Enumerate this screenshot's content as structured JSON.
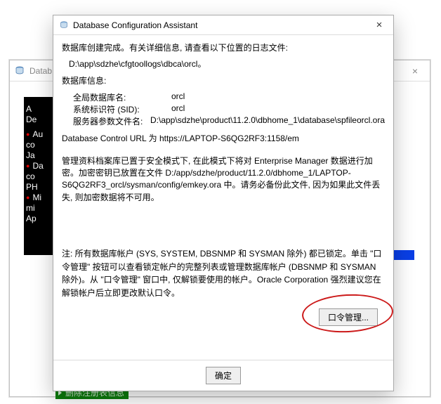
{
  "parentWindow": {
    "titlePrefix": "Datab",
    "close": "×",
    "blackPanel": {
      "l1": "A",
      "l2": "De",
      "l3": "Au",
      "l4": "co",
      "l5": "Ja",
      "l6": "Da",
      "l7": "co",
      "l8": "PH",
      "l9": "Mi",
      "l10": "mi",
      "l11": "Ap"
    },
    "greenSnippet": "删除注册表信息"
  },
  "dialog": {
    "title": "Database Configuration Assistant",
    "close": "×",
    "p1": "数据库创建完成。有关详细信息, 请查看以下位置的日志文件:",
    "p1_path": "D:\\app\\sdzhe\\cfgtoollogs\\dbca\\orcl。",
    "dbinfo_header": "数据库信息:",
    "row_globalname_k": "全局数据库名:",
    "row_globalname_v": "orcl",
    "row_sid_k": "系统标识符 (SID):",
    "row_sid_v": "orcl",
    "row_spfile_k": "服务器参数文件名:",
    "row_spfile_v": "D:\\app\\sdzhe\\product\\11.2.0\\dbhome_1\\database\\spfileorcl.ora",
    "p3": "Database Control URL 为 https://LAPTOP-S6QG2RF3:1158/em",
    "p4": "管理资料档案库已置于安全模式下, 在此模式下将对 Enterprise Manager 数据进行加密。加密密钥已放置在文件 D:/app/sdzhe/product/11.2.0/dbhome_1/LAPTOP-S6QG2RF3_orcl/sysman/config/emkey.ora 中。请务必备份此文件, 因为如果此文件丢失, 则加密数据将不可用。",
    "note": "注: 所有数据库帐户 (SYS, SYSTEM, DBSNMP 和 SYSMAN 除外) 都已锁定。单击 \"口令管理\" 按钮可以查看锁定帐户的完整列表或管理数据库帐户 (DBSNMP 和 SYSMAN 除外)。从 \"口令管理\" 窗口中, 仅解锁要使用的帐户。Oracle Corporation 强烈建议您在解锁帐户后立即更改默认口令。",
    "btn_pwd": "口令管理...",
    "btn_ok": "确定"
  }
}
